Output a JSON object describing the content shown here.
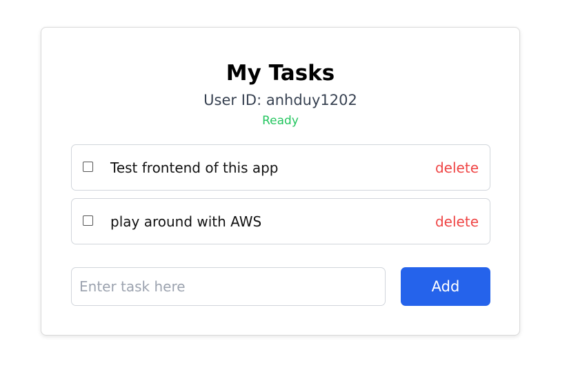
{
  "header": {
    "title": "My Tasks",
    "user_id_text": "User ID: anhduy1202",
    "status_text": "Ready"
  },
  "tasks": [
    {
      "text": "Test frontend of this app",
      "completed": false,
      "delete_label": "delete"
    },
    {
      "text": "play around with AWS",
      "completed": false,
      "delete_label": "delete"
    }
  ],
  "new_task": {
    "value": "",
    "placeholder": "Enter task here",
    "add_label": "Add"
  },
  "colors": {
    "status": "#22c55e",
    "delete": "#ef4444",
    "add_button": "#2563eb"
  }
}
